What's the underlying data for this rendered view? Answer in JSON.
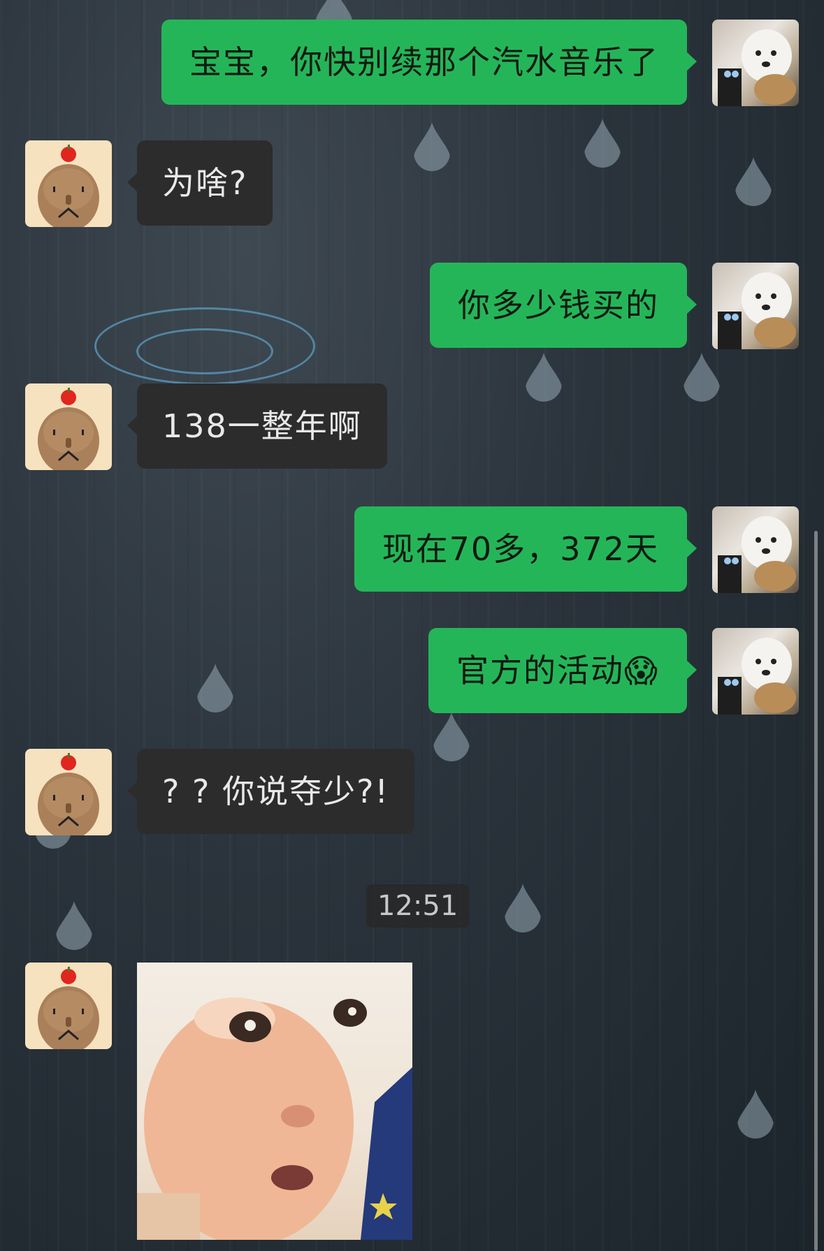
{
  "messages": [
    {
      "sender": "me",
      "text": "宝宝，你快别续那个汽水音乐了"
    },
    {
      "sender": "them",
      "text": "为啥?"
    },
    {
      "sender": "me",
      "text": "你多少钱买的"
    },
    {
      "sender": "them",
      "text": "138一整年啊"
    },
    {
      "sender": "me",
      "text": "现在70多，372天"
    },
    {
      "sender": "me",
      "text": "官方的活动",
      "emoji": "😱"
    },
    {
      "sender": "them",
      "text": "? ?  你说夺少?!"
    }
  ],
  "timestamp": "12:51",
  "last_message": {
    "sender": "them",
    "type": "image",
    "icon": "surprised-baby-photo"
  },
  "colors": {
    "my_bubble": "#25b559",
    "their_bubble": "#2c2c2c",
    "background": "#2a333b"
  },
  "icons": {
    "left_avatar": "capybara-with-apple-icon",
    "right_avatar": "white-dog-photo-icon"
  }
}
